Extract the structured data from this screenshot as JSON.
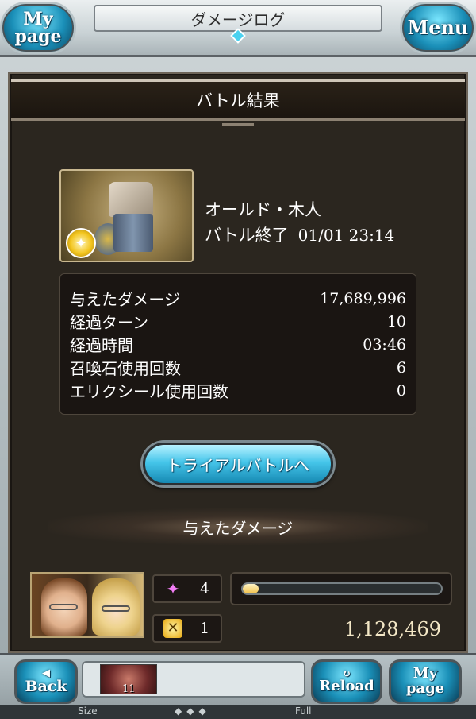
{
  "header": {
    "title": "ダメージログ",
    "left_button": [
      "My",
      "page"
    ],
    "right_button": "Menu"
  },
  "panel": {
    "title": "バトル結果"
  },
  "boss": {
    "name": "オールド・木人",
    "status": "バトル終了",
    "datetime": "01/01 23:14",
    "element": "light-icon"
  },
  "stats": [
    {
      "label": "与えたダメージ",
      "value": "17,689,996"
    },
    {
      "label": "経過ターン",
      "value": "10"
    },
    {
      "label": "経過時間",
      "value": "03:46"
    },
    {
      "label": "召喚石使用回数",
      "value": "6"
    },
    {
      "label": "エリクシール使用回数",
      "value": "0"
    }
  ],
  "trial_button": "トライアルバトルへ",
  "damage_section": {
    "title": "与えたダメージ",
    "player": {
      "count_a": "4",
      "count_b": "1",
      "bar_fraction": 0.08,
      "total": "1,128,469"
    }
  },
  "footer": {
    "back": "Back",
    "reload": "Reload",
    "mypage": [
      "My",
      "page"
    ],
    "thumb_number": "11",
    "size_label": "Size",
    "full_label": "Full"
  },
  "colors": {
    "accent": "#46c6ea",
    "panel_bg": "#2b261f"
  }
}
